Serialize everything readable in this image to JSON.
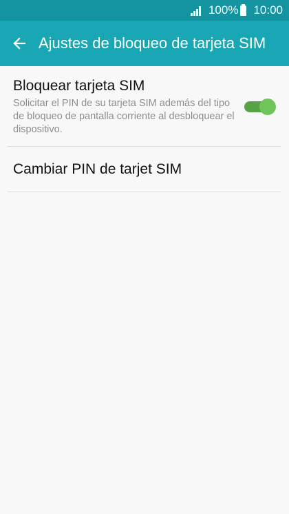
{
  "status_bar": {
    "battery_percent": "100%",
    "time": "10:00",
    "signal_icon": "signal-icon",
    "battery_icon": "battery-icon"
  },
  "app_bar": {
    "back_icon": "arrow-left-icon",
    "title": "Ajustes de bloqueo de tarjeta SIM"
  },
  "settings": [
    {
      "title": "Bloquear tarjeta SIM",
      "summary": "Solicitar el PIN de su tarjeta SIM además del tipo de bloqueo de pantalla corriente al desbloquear el dispositivo.",
      "toggle_on": true
    },
    {
      "title": "Cambiar PIN de tarjet SIM"
    }
  ],
  "colors": {
    "status_bar": "#1493a0",
    "app_bar": "#1aa7b5",
    "toggle_track": "#57a447",
    "toggle_thumb": "#6fc55a",
    "background": "#f8f8f8"
  }
}
